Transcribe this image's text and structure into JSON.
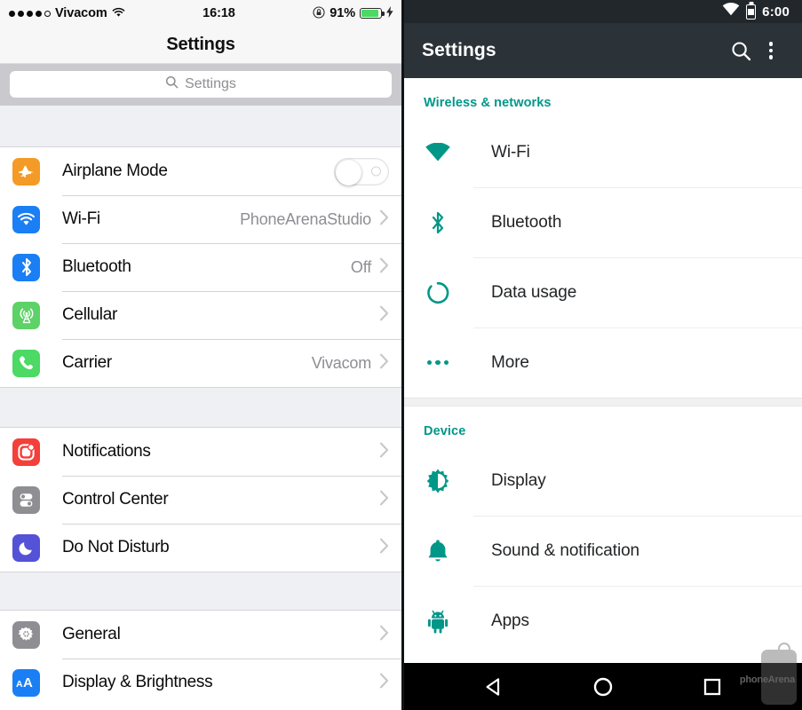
{
  "ios": {
    "status_bar": {
      "signal_dots_filled": 4,
      "signal_dots_empty": 1,
      "carrier": "Vivacom",
      "wifi_icon": "wifi-icon",
      "time": "16:18",
      "rotation_lock_icon": "rotation-lock-icon",
      "battery_percent": "91%",
      "battery_level": 91,
      "charging_icon": "lightning-bolt-icon",
      "battery_color": "#4cd964"
    },
    "nav": {
      "title": "Settings"
    },
    "search": {
      "placeholder": "Settings",
      "icon": "search-icon"
    },
    "groups": [
      {
        "id": "connectivity",
        "rows": [
          {
            "label": "Airplane Mode",
            "icon": "airplane-icon",
            "icon_color": "#f49a26",
            "control": "toggle",
            "toggle_on": false
          },
          {
            "label": "Wi-Fi",
            "icon": "wifi-icon",
            "icon_color": "#1a7ef4",
            "value": "PhoneArenaStudio",
            "control": "chevron"
          },
          {
            "label": "Bluetooth",
            "icon": "bluetooth-icon",
            "icon_color": "#1a7ef4",
            "value": "Off",
            "control": "chevron"
          },
          {
            "label": "Cellular",
            "icon": "cell-tower-icon",
            "icon_color": "#5dd267",
            "value": "",
            "control": "chevron"
          },
          {
            "label": "Carrier",
            "icon": "phone-icon",
            "icon_color": "#4cd964",
            "value": "Vivacom",
            "control": "chevron"
          }
        ]
      },
      {
        "id": "notifications",
        "rows": [
          {
            "label": "Notifications",
            "icon": "notifications-icon",
            "icon_color": "#f43f3b",
            "value": "",
            "control": "chevron"
          },
          {
            "label": "Control Center",
            "icon": "control-center-icon",
            "icon_color": "#8e8e93",
            "value": "",
            "control": "chevron"
          },
          {
            "label": "Do Not Disturb",
            "icon": "moon-icon",
            "icon_color": "#5452d6",
            "value": "",
            "control": "chevron"
          }
        ]
      },
      {
        "id": "system",
        "rows": [
          {
            "label": "General",
            "icon": "gear-icon",
            "icon_color": "#8e8e93",
            "value": "",
            "control": "chevron"
          },
          {
            "label": "Display & Brightness",
            "icon": "text-size-icon",
            "icon_color": "#1a7ef4",
            "value": "",
            "control": "chevron"
          }
        ]
      }
    ]
  },
  "android": {
    "status_bar": {
      "wifi_icon": "wifi-icon",
      "battery_icon": "battery-icon",
      "time": "6:00"
    },
    "app_bar": {
      "title": "Settings",
      "search_icon": "search-icon",
      "overflow_icon": "kebab-menu-icon"
    },
    "accent_color": "#009788",
    "sections": [
      {
        "title": "Wireless & networks",
        "rows": [
          {
            "label": "Wi-Fi",
            "icon": "wifi-icon"
          },
          {
            "label": "Bluetooth",
            "icon": "bluetooth-icon"
          },
          {
            "label": "Data usage",
            "icon": "data-usage-icon"
          },
          {
            "label": "More",
            "icon": "more-dots-icon"
          }
        ]
      },
      {
        "title": "Device",
        "rows": [
          {
            "label": "Display",
            "icon": "brightness-icon"
          },
          {
            "label": "Sound & notification",
            "icon": "bell-icon"
          },
          {
            "label": "Apps",
            "icon": "android-robot-icon"
          }
        ]
      }
    ],
    "nav_bar": {
      "back_icon": "back-triangle-icon",
      "home_icon": "home-circle-icon",
      "recents_icon": "recents-square-icon"
    },
    "watermark": {
      "text": "phoneArena"
    }
  }
}
